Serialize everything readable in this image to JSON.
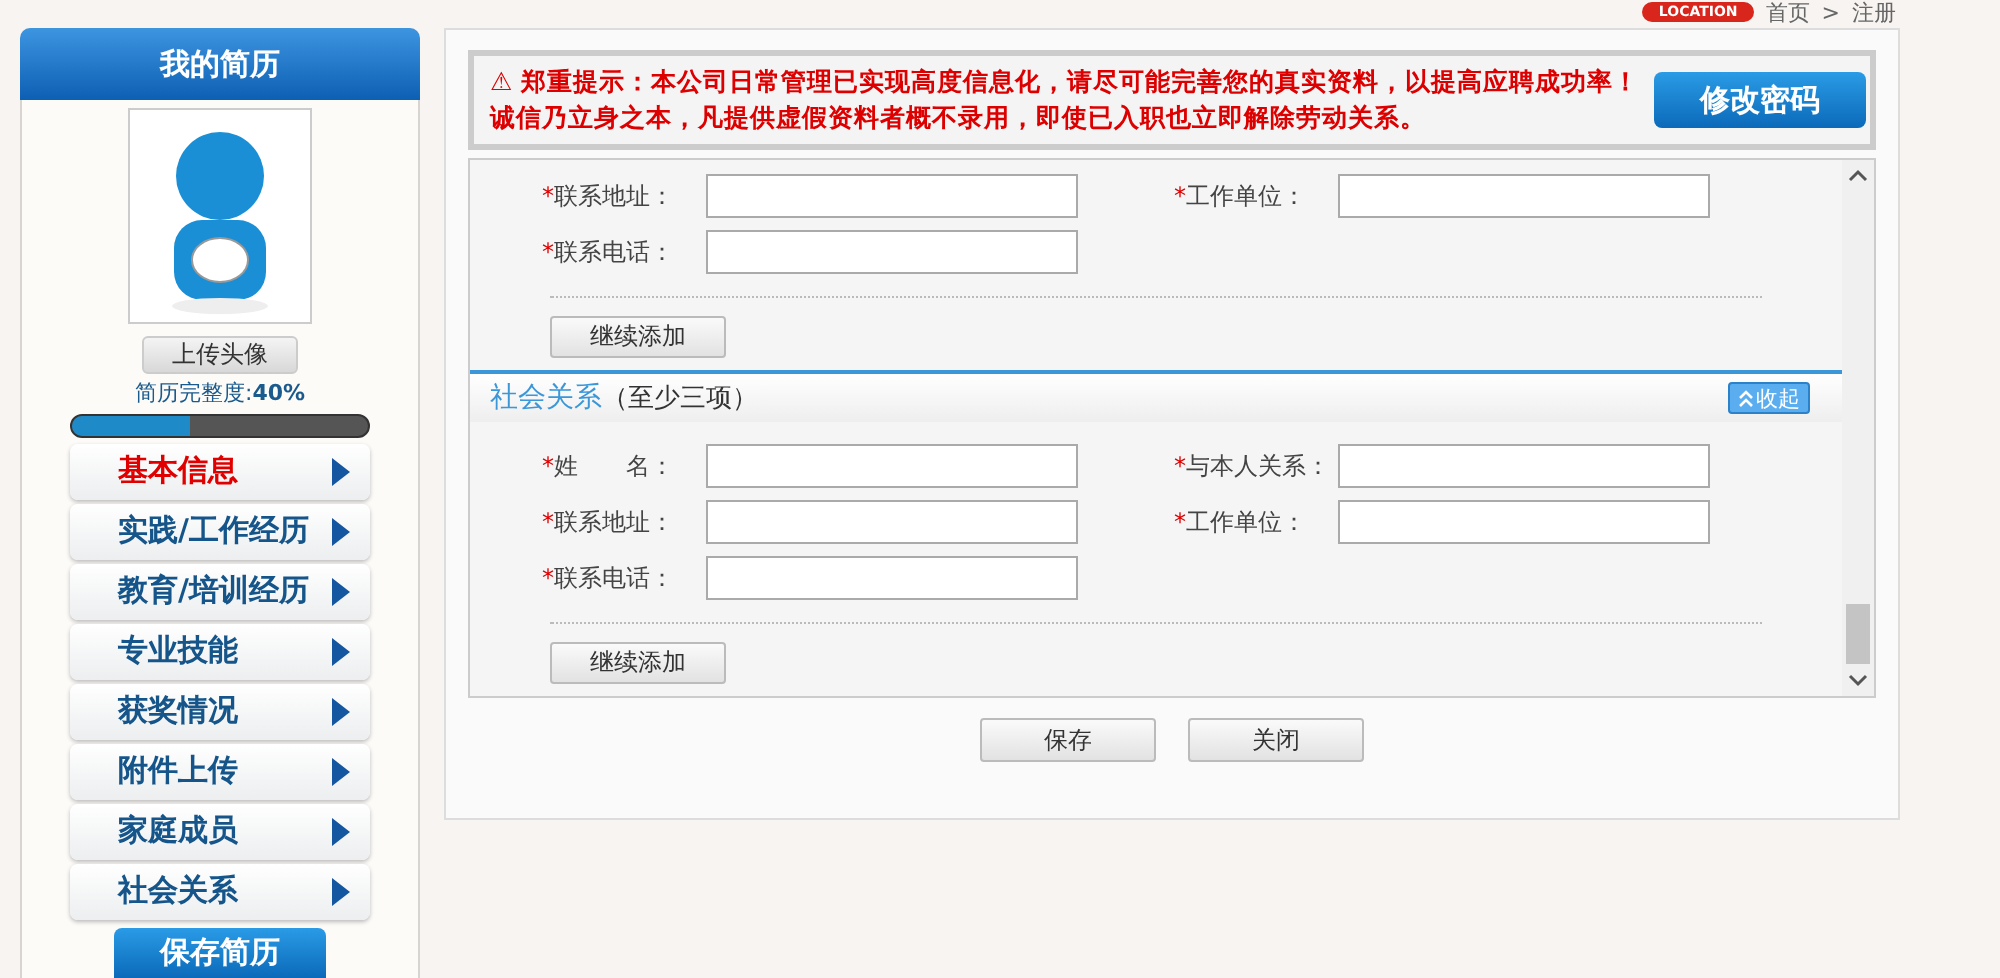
{
  "breadcrumb": {
    "badge": "LOCATION",
    "items": [
      "首页",
      "注册"
    ],
    "separator": ">"
  },
  "sidebar": {
    "title": "我的简历",
    "upload_button": "上传头像",
    "completeness_label": "简历完整度:",
    "completeness_value": "40%",
    "level": 0.4,
    "items": [
      {
        "label": "基本信息",
        "selected": true
      },
      {
        "label": "实践/工作经历",
        "selected": false
      },
      {
        "label": "教育/培训经历",
        "selected": false
      },
      {
        "label": "专业技能",
        "selected": false
      },
      {
        "label": "获奖情况",
        "selected": false
      },
      {
        "label": "附件上传",
        "selected": false
      },
      {
        "label": "家庭成员",
        "selected": false
      },
      {
        "label": "社会关系",
        "selected": false
      }
    ],
    "save_button": "保存简历"
  },
  "notice": {
    "icon": "⚠",
    "lines": [
      "郑重提示：本公司日常管理已实现高度信息化，请尽可能完善您的真实资料，以提高应聘成功率！",
      "诚信乃立身之本，凡提供虚假资料者概不录用，即使已入职也立即解除劳动关系。"
    ],
    "button": "修改密码"
  },
  "sections": [
    {
      "rows": [
        [
          {
            "mark": "*",
            "label": "联系地址："
          },
          {
            "mark": "*",
            "label": "工作单位："
          }
        ],
        [
          {
            "mark": "*",
            "label": "联系电话："
          }
        ]
      ],
      "add_button": "继续添加"
    },
    {
      "title": "社会关系",
      "subtitle": "（至少三项）",
      "collapse": "收起",
      "rows": [
        [
          {
            "mark": "*",
            "label": "姓　　名："
          },
          {
            "mark": "*",
            "label": "与本人关系："
          }
        ],
        [
          {
            "mark": "*",
            "label": "联系地址："
          },
          {
            "mark": "*",
            "label": "工作单位："
          }
        ],
        [
          {
            "mark": "*",
            "label": "联系电话："
          }
        ]
      ],
      "add_button": "继续添加"
    }
  ],
  "footer_buttons": [
    "保存",
    "关闭"
  ]
}
